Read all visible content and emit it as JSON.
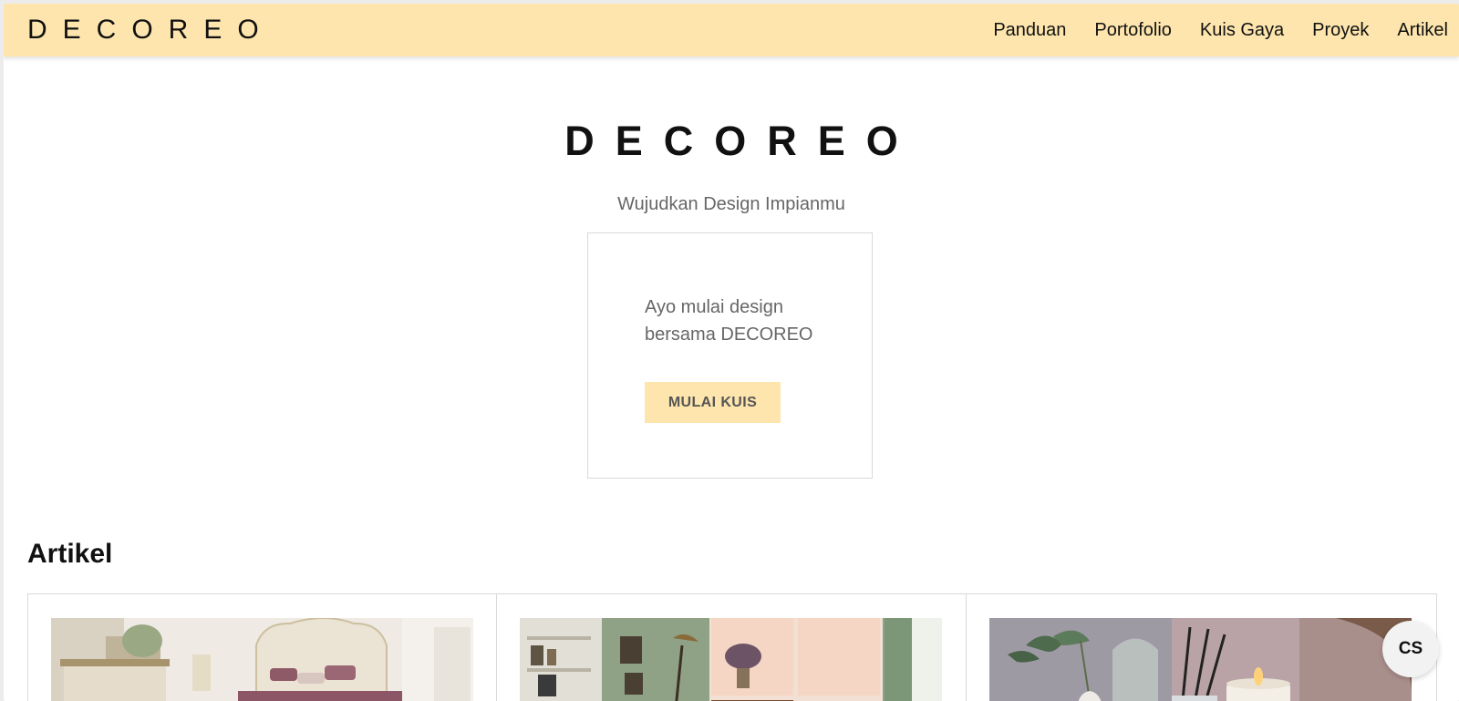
{
  "navbar": {
    "brand": "DECOREO",
    "links": [
      "Panduan",
      "Portofolio",
      "Kuis Gaya",
      "Proyek",
      "Artikel"
    ]
  },
  "hero": {
    "title": "DECOREO",
    "subtitle": "Wujudkan Design Impianmu"
  },
  "quiz_card": {
    "text": "Ayo mulai design bersama DECOREO",
    "button_label": "MULAI KUIS"
  },
  "articles": {
    "heading": "Artikel",
    "items": [
      {
        "image": "classic-bedroom-photo"
      },
      {
        "image": "green-living-room-photo"
      },
      {
        "image": "home-decor-still-life-photo"
      }
    ]
  },
  "chat_button": {
    "label": "CS"
  },
  "colors": {
    "accent": "#fde5ad",
    "text_dark": "#111111",
    "text_muted": "#666666",
    "border": "#d9d9d9"
  }
}
